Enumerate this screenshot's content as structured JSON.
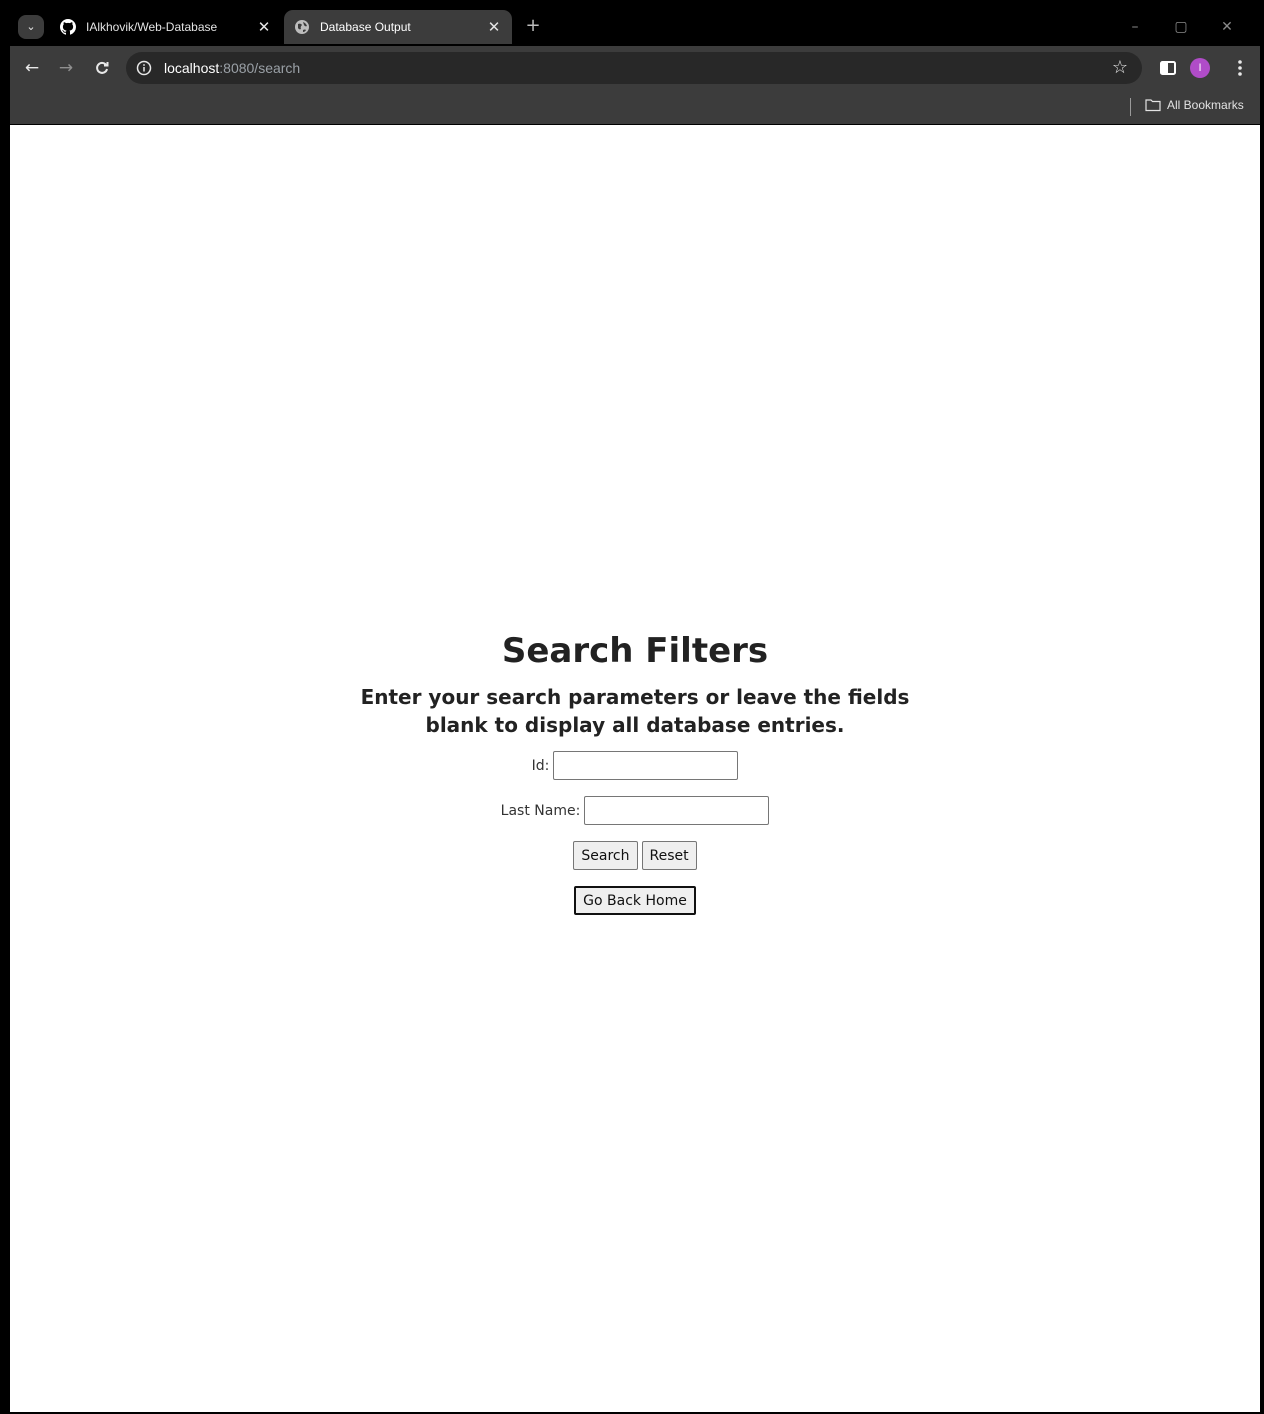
{
  "browser": {
    "tabs": [
      {
        "title": "IAlkhovik/Web-Database",
        "active": false,
        "favicon": "github-icon"
      },
      {
        "title": "Database Output",
        "active": true,
        "favicon": "globe-icon"
      }
    ],
    "url_host": "localhost",
    "url_rest": ":8080/search",
    "bookmarks_label": "All Bookmarks",
    "avatar_initial": "I",
    "avatar_color": "#b04cc8"
  },
  "page": {
    "title": "Search Filters",
    "subtitle": "Enter your search parameters or leave the fields blank to display all database entries.",
    "fields": {
      "id_label": "Id:",
      "id_value": "",
      "last_name_label": "Last Name:",
      "last_name_value": ""
    },
    "buttons": {
      "search": "Search",
      "reset": "Reset",
      "home": "Go Back Home"
    }
  }
}
